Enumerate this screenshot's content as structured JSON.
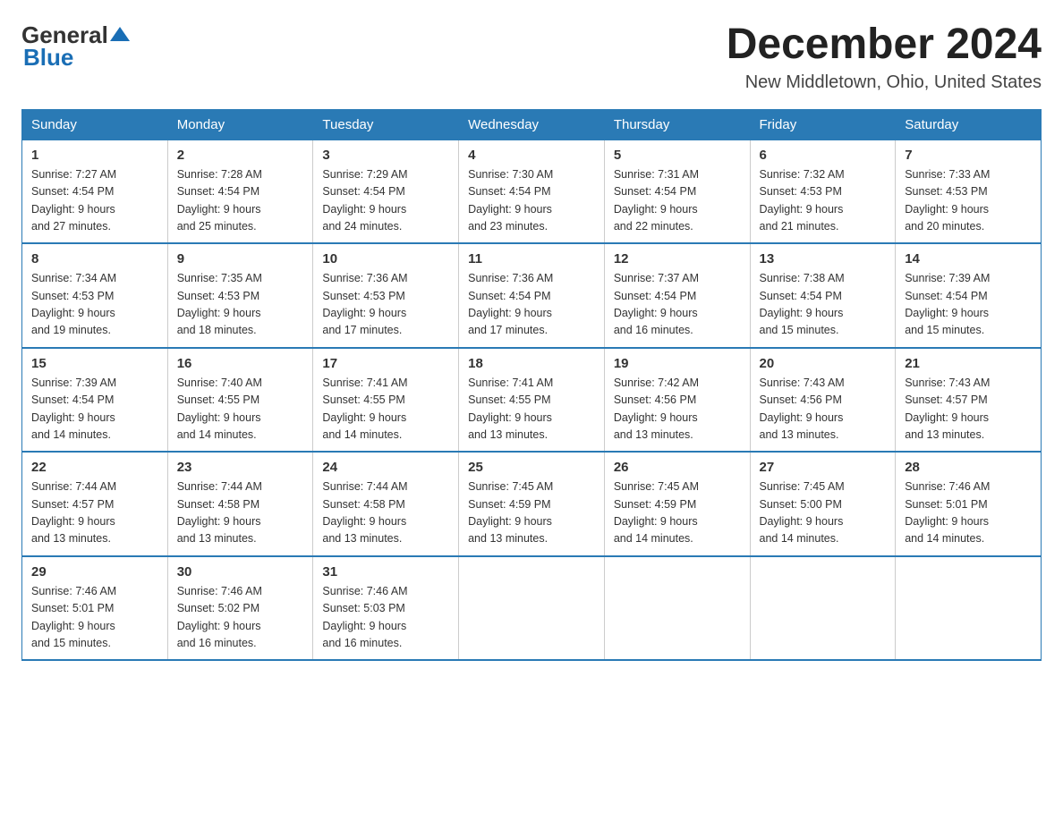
{
  "header": {
    "logo_general": "General",
    "logo_blue": "Blue",
    "month_title": "December 2024",
    "location": "New Middletown, Ohio, United States"
  },
  "weekdays": [
    "Sunday",
    "Monday",
    "Tuesday",
    "Wednesday",
    "Thursday",
    "Friday",
    "Saturday"
  ],
  "weeks": [
    [
      {
        "day": "1",
        "sunrise": "7:27 AM",
        "sunset": "4:54 PM",
        "daylight": "9 hours and 27 minutes."
      },
      {
        "day": "2",
        "sunrise": "7:28 AM",
        "sunset": "4:54 PM",
        "daylight": "9 hours and 25 minutes."
      },
      {
        "day": "3",
        "sunrise": "7:29 AM",
        "sunset": "4:54 PM",
        "daylight": "9 hours and 24 minutes."
      },
      {
        "day": "4",
        "sunrise": "7:30 AM",
        "sunset": "4:54 PM",
        "daylight": "9 hours and 23 minutes."
      },
      {
        "day": "5",
        "sunrise": "7:31 AM",
        "sunset": "4:54 PM",
        "daylight": "9 hours and 22 minutes."
      },
      {
        "day": "6",
        "sunrise": "7:32 AM",
        "sunset": "4:53 PM",
        "daylight": "9 hours and 21 minutes."
      },
      {
        "day": "7",
        "sunrise": "7:33 AM",
        "sunset": "4:53 PM",
        "daylight": "9 hours and 20 minutes."
      }
    ],
    [
      {
        "day": "8",
        "sunrise": "7:34 AM",
        "sunset": "4:53 PM",
        "daylight": "9 hours and 19 minutes."
      },
      {
        "day": "9",
        "sunrise": "7:35 AM",
        "sunset": "4:53 PM",
        "daylight": "9 hours and 18 minutes."
      },
      {
        "day": "10",
        "sunrise": "7:36 AM",
        "sunset": "4:53 PM",
        "daylight": "9 hours and 17 minutes."
      },
      {
        "day": "11",
        "sunrise": "7:36 AM",
        "sunset": "4:54 PM",
        "daylight": "9 hours and 17 minutes."
      },
      {
        "day": "12",
        "sunrise": "7:37 AM",
        "sunset": "4:54 PM",
        "daylight": "9 hours and 16 minutes."
      },
      {
        "day": "13",
        "sunrise": "7:38 AM",
        "sunset": "4:54 PM",
        "daylight": "9 hours and 15 minutes."
      },
      {
        "day": "14",
        "sunrise": "7:39 AM",
        "sunset": "4:54 PM",
        "daylight": "9 hours and 15 minutes."
      }
    ],
    [
      {
        "day": "15",
        "sunrise": "7:39 AM",
        "sunset": "4:54 PM",
        "daylight": "9 hours and 14 minutes."
      },
      {
        "day": "16",
        "sunrise": "7:40 AM",
        "sunset": "4:55 PM",
        "daylight": "9 hours and 14 minutes."
      },
      {
        "day": "17",
        "sunrise": "7:41 AM",
        "sunset": "4:55 PM",
        "daylight": "9 hours and 14 minutes."
      },
      {
        "day": "18",
        "sunrise": "7:41 AM",
        "sunset": "4:55 PM",
        "daylight": "9 hours and 13 minutes."
      },
      {
        "day": "19",
        "sunrise": "7:42 AM",
        "sunset": "4:56 PM",
        "daylight": "9 hours and 13 minutes."
      },
      {
        "day": "20",
        "sunrise": "7:43 AM",
        "sunset": "4:56 PM",
        "daylight": "9 hours and 13 minutes."
      },
      {
        "day": "21",
        "sunrise": "7:43 AM",
        "sunset": "4:57 PM",
        "daylight": "9 hours and 13 minutes."
      }
    ],
    [
      {
        "day": "22",
        "sunrise": "7:44 AM",
        "sunset": "4:57 PM",
        "daylight": "9 hours and 13 minutes."
      },
      {
        "day": "23",
        "sunrise": "7:44 AM",
        "sunset": "4:58 PM",
        "daylight": "9 hours and 13 minutes."
      },
      {
        "day": "24",
        "sunrise": "7:44 AM",
        "sunset": "4:58 PM",
        "daylight": "9 hours and 13 minutes."
      },
      {
        "day": "25",
        "sunrise": "7:45 AM",
        "sunset": "4:59 PM",
        "daylight": "9 hours and 13 minutes."
      },
      {
        "day": "26",
        "sunrise": "7:45 AM",
        "sunset": "4:59 PM",
        "daylight": "9 hours and 14 minutes."
      },
      {
        "day": "27",
        "sunrise": "7:45 AM",
        "sunset": "5:00 PM",
        "daylight": "9 hours and 14 minutes."
      },
      {
        "day": "28",
        "sunrise": "7:46 AM",
        "sunset": "5:01 PM",
        "daylight": "9 hours and 14 minutes."
      }
    ],
    [
      {
        "day": "29",
        "sunrise": "7:46 AM",
        "sunset": "5:01 PM",
        "daylight": "9 hours and 15 minutes."
      },
      {
        "day": "30",
        "sunrise": "7:46 AM",
        "sunset": "5:02 PM",
        "daylight": "9 hours and 16 minutes."
      },
      {
        "day": "31",
        "sunrise": "7:46 AM",
        "sunset": "5:03 PM",
        "daylight": "9 hours and 16 minutes."
      },
      null,
      null,
      null,
      null
    ]
  ],
  "labels": {
    "sunrise": "Sunrise:",
    "sunset": "Sunset:",
    "daylight": "Daylight:"
  }
}
